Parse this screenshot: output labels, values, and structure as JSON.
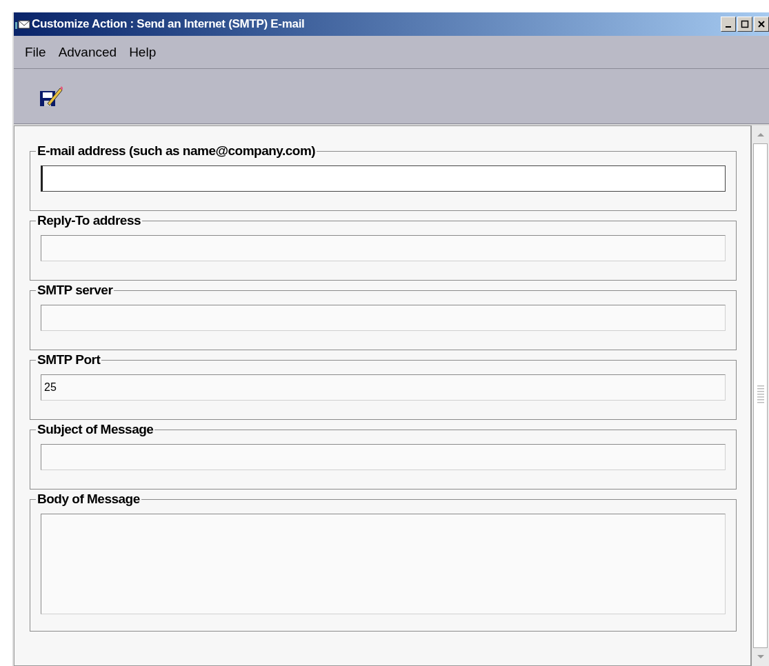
{
  "window": {
    "title": "Customize Action : Send an Internet (SMTP) E-mail"
  },
  "menu": [
    "File",
    "Advanced",
    "Help"
  ],
  "fields": [
    {
      "label": "E-mail address (such as name@company.com)",
      "kind": "line",
      "focused": true
    },
    {
      "label": "Reply-To address",
      "kind": "line",
      "focused": false
    },
    {
      "label": "SMTP server",
      "kind": "line",
      "focused": false
    },
    {
      "label": "SMTP Port",
      "kind": "line",
      "value": "25",
      "focused": false
    },
    {
      "label": "Subject of Message",
      "kind": "line",
      "focused": false
    },
    {
      "label": "Body of Message",
      "kind": "multi",
      "focused": false
    }
  ]
}
